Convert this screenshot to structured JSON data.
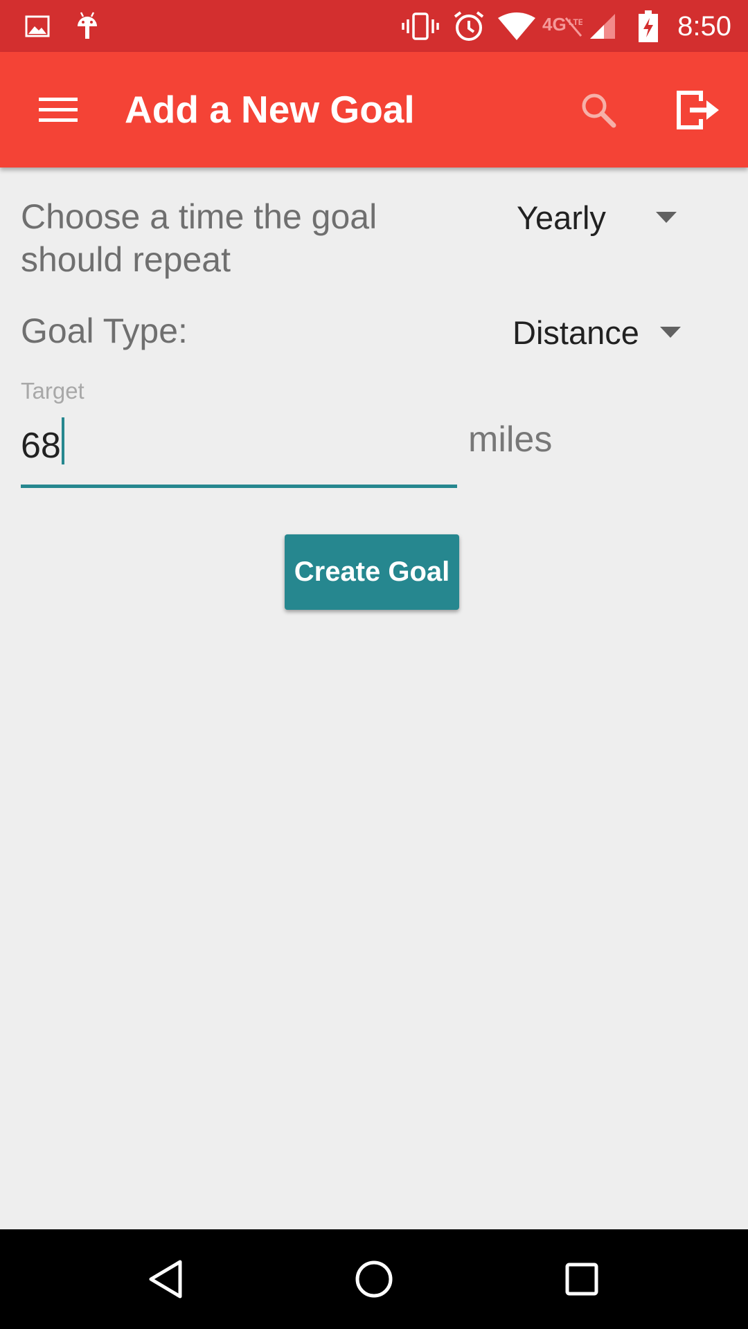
{
  "status_bar": {
    "time": "8:50",
    "background": "#d32f2f",
    "icons": [
      "image-icon",
      "android-icon",
      "vibrate-icon",
      "alarm-icon",
      "wifi-icon",
      "lte-icon",
      "signal-icon",
      "battery-charging-icon"
    ],
    "network_label": "4G LTE"
  },
  "app_bar": {
    "title": "Add a New Goal",
    "background": "#f44336",
    "icons": [
      "menu-icon",
      "search-icon",
      "logout-icon"
    ]
  },
  "form": {
    "repeat_label": "Choose a time the goal should repeat",
    "repeat_value": "Yearly",
    "goal_type_label": "Goal Type:",
    "goal_type_value": "Distance",
    "target_hint": "Target",
    "target_value": "68",
    "unit": "miles",
    "submit_label": "Create Goal",
    "accent": "#26878f"
  },
  "nav_bar": {
    "icons": [
      "back-icon",
      "home-icon",
      "recents-icon"
    ]
  }
}
